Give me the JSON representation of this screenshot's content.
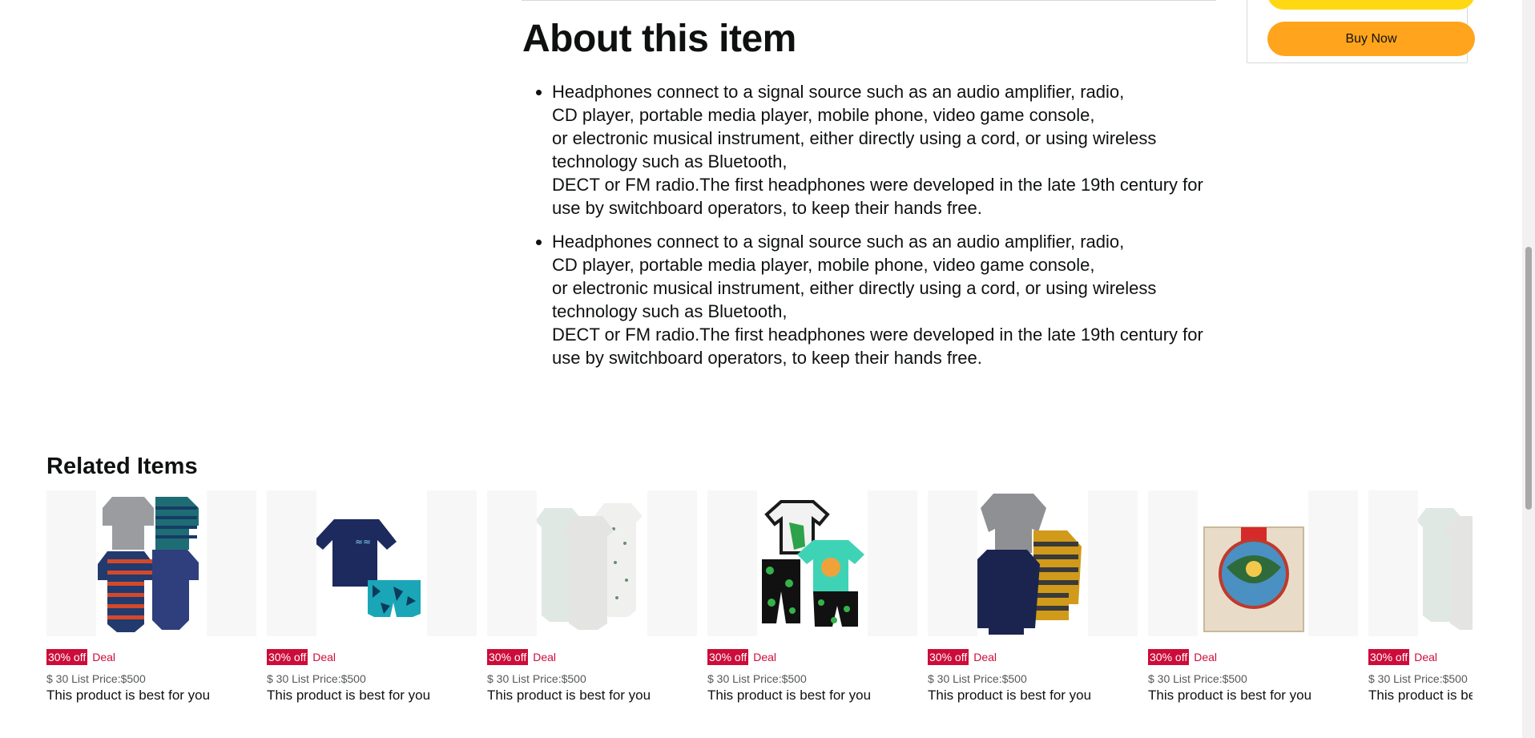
{
  "buy_box": {
    "buy_now_label": "Buy Now"
  },
  "about": {
    "title": "About this item",
    "bullets": [
      "Headphones connect to a signal source such as an audio amplifier, radio,\nCD player, portable media player, mobile phone, video game console,\nor electronic musical instrument, either directly using a cord, or using wireless technology such as Bluetooth,\nDECT or FM radio.The first headphones were developed in the late 19th century for use by switchboard operators, to keep their hands free.",
      "Headphones connect to a signal source such as an audio amplifier, radio,\nCD player, portable media player, mobile phone, video game console,\nor electronic musical instrument, either directly using a cord, or using wireless technology such as Bluetooth,\nDECT or FM radio.The first headphones were developed in the late 19th century for use by switchboard operators, to keep their hands free."
    ]
  },
  "related": {
    "title": "Related Items",
    "items": [
      {
        "image": "baby-bodysuits-striped",
        "badge": "30% off",
        "deal": "Deal",
        "price": "$ 30 List Price:$500",
        "desc": "This product is best for you"
      },
      {
        "image": "navy-rashguard-swim-set",
        "badge": "30% off",
        "deal": "Deal",
        "price": "$ 30 List Price:$500",
        "desc": "This product is best for you"
      },
      {
        "image": "sleep-gowns-set",
        "badge": "30% off",
        "deal": "Deal",
        "price": "$ 30 List Price:$500",
        "desc": "This product is best for you"
      },
      {
        "image": "dinosaur-pajama-set",
        "badge": "30% off",
        "deal": "Deal",
        "price": "$ 30 List Price:$500",
        "desc": "This product is best for you"
      },
      {
        "image": "toddler-sweaters-set",
        "badge": "30% off",
        "deal": "Deal",
        "price": "$ 30 List Price:$500",
        "desc": "This product is best for you"
      },
      {
        "image": "avatar-crossroads-of-destiny-game",
        "badge": "30% off",
        "deal": "Deal",
        "price": "$ 30 List Price:$500",
        "desc": "This product is best for you"
      },
      {
        "image": "sleep-gowns-set",
        "badge": "30% off",
        "deal": "Deal",
        "price": "$ 30 List Price:$500",
        "desc": "This product is best for you"
      }
    ]
  },
  "colors": {
    "buy_now": "#ffa41c",
    "add_to_cart": "#ffd814",
    "deal_red": "#cc0c39"
  }
}
